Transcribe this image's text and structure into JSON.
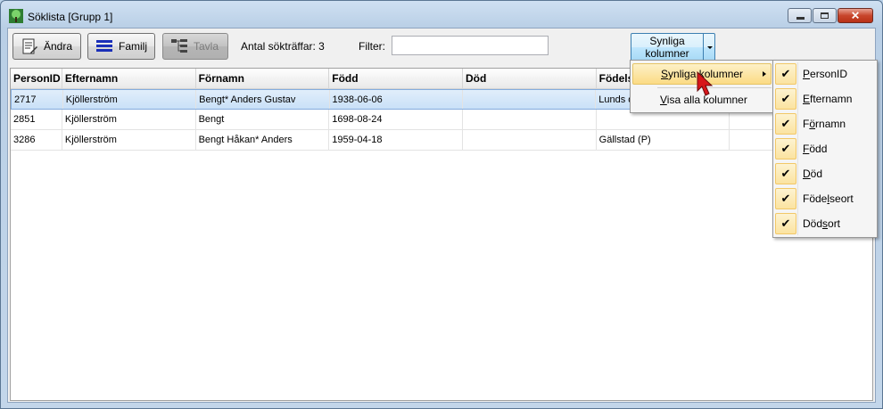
{
  "window": {
    "title": "Söklista [Grupp 1]"
  },
  "toolbar": {
    "andra_label": "Ändra",
    "familj_label": "Familj",
    "tavla_label": "Tavla",
    "hits_text": "Antal sökträffar: 3",
    "filter_label": "Filter:",
    "filter_value": "",
    "visible_columns_line1": "Synliga",
    "visible_columns_line2": "kolumner"
  },
  "grid": {
    "columns": [
      "PersonID",
      "Efternamn",
      "Förnamn",
      "Född",
      "Död",
      "Födelseort",
      ""
    ],
    "rows": [
      [
        "2717",
        "Kjöllerström",
        "Bengt* Anders Gustav",
        "1938-06-06",
        "",
        "Lunds d",
        ""
      ],
      [
        "2851",
        "Kjöllerström",
        "Bengt",
        "1698-08-24",
        "",
        "",
        ""
      ],
      [
        "3286",
        "Kjöllerström",
        "Bengt Håkan* Anders",
        "1959-04-18",
        "",
        "Gällstad (P)",
        ""
      ]
    ]
  },
  "menu": {
    "item1_pre": "",
    "item1_ul": "S",
    "item1_post": "ynliga kolumner",
    "item2_pre": "",
    "item2_ul": "V",
    "item2_post": "isa alla kolumner"
  },
  "submenu": [
    {
      "pre": "",
      "ul": "P",
      "post": "ersonID",
      "checked": "✔"
    },
    {
      "pre": "",
      "ul": "E",
      "post": "fternamn",
      "checked": "✔"
    },
    {
      "pre": "F",
      "ul": "ö",
      "post": "rnamn",
      "checked": "✔"
    },
    {
      "pre": "",
      "ul": "F",
      "post": "ödd",
      "checked": "✔"
    },
    {
      "pre": "",
      "ul": "D",
      "post": "öd",
      "checked": "✔"
    },
    {
      "pre": "Föde",
      "ul": "l",
      "post": "seort",
      "checked": "✔"
    },
    {
      "pre": "Död",
      "ul": "s",
      "post": "ort",
      "checked": "✔"
    }
  ],
  "colors": {
    "selected_row": "#c9e0f7",
    "menu_highlight": "#fbdb84"
  }
}
